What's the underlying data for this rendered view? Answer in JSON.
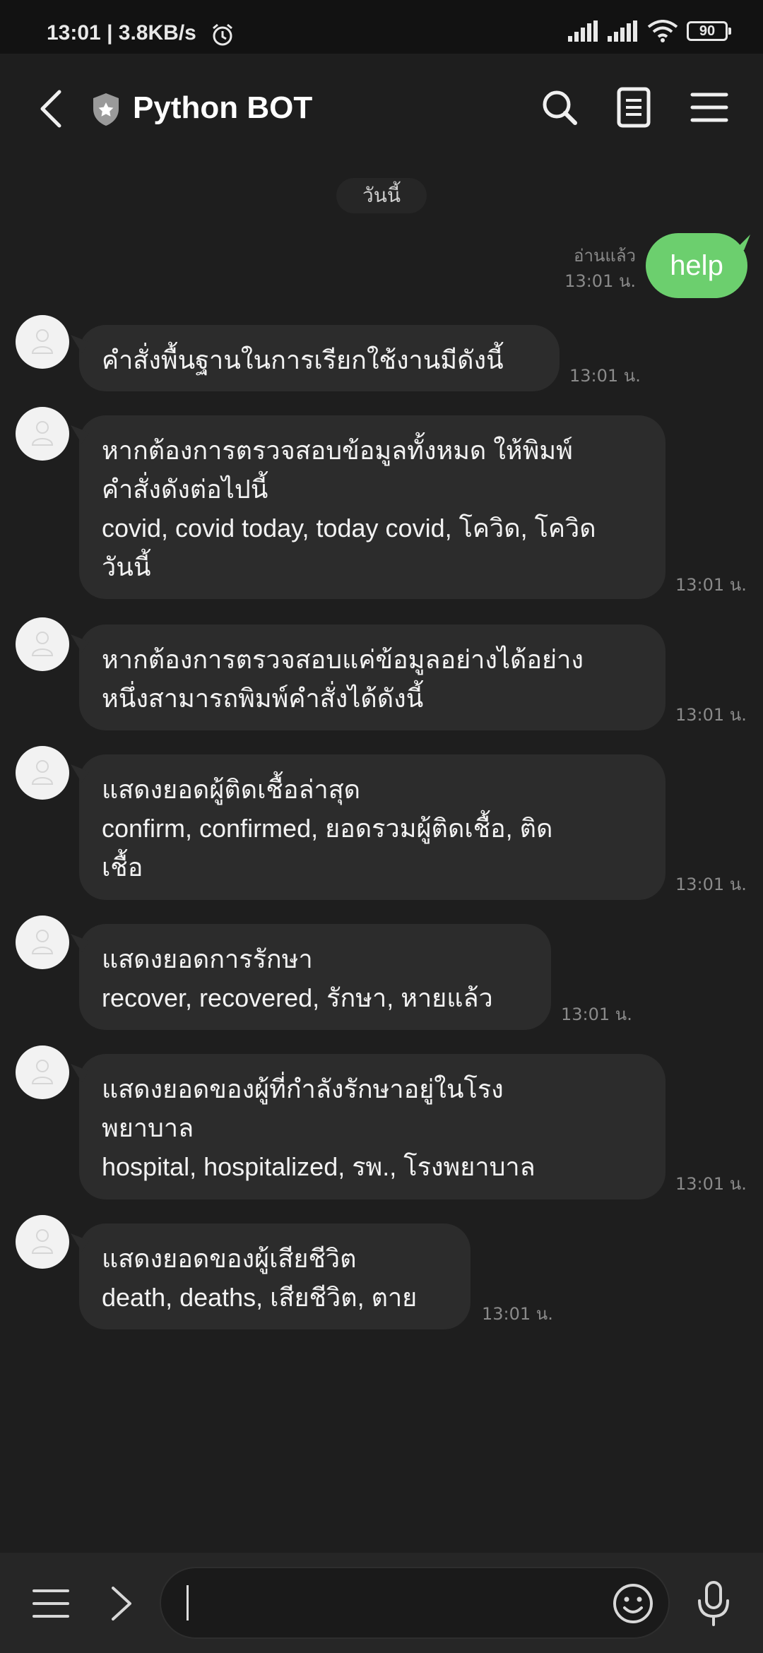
{
  "status_bar": {
    "time_speed": "13:01 | 3.8KB/s",
    "battery": "90",
    "icons": [
      "alarm-icon",
      "signal-icon",
      "signal-icon",
      "wifi-icon",
      "battery-icon"
    ]
  },
  "header": {
    "title": "Python BOT",
    "icons": [
      "back-icon",
      "shield-star-icon",
      "search-icon",
      "notes-icon",
      "menu-icon"
    ]
  },
  "chat": {
    "date_label": "วันนี้",
    "sent": {
      "status": "อ่านแล้ว",
      "time": "13:01 น.",
      "text": "help"
    },
    "received": [
      {
        "text": "คำสั่งพื้นฐานในการเรียกใช้งานมีดังนี้",
        "time": "13:01 น."
      },
      {
        "text": "หากต้องการตรวจสอบข้อมูลทั้งหมด ให้พิมพ์\nคำสั่งดังต่อไปนี้\ncovid, covid today, today covid, โควิด, โควิด\nวันนี้",
        "time": "13:01 น."
      },
      {
        "text": "หากต้องการตรวจสอบแค่ข้อมูลอย่างได้อย่าง\nหนึ่งสามารถพิมพ์คำสั่งได้ดังนี้",
        "time": "13:01 น."
      },
      {
        "text": "แสดงยอดผู้ติดเชื้อล่าสุด\nconfirm, confirmed, ยอดรวมผู้ติดเชื้อ, ติด\nเชื้อ",
        "time": "13:01 น."
      },
      {
        "text": "แสดงยอดการรักษา\nrecover, recovered, รักษา, หายแล้ว",
        "time": "13:01 น."
      },
      {
        "text": "แสดงยอดของผู้ที่กำลังรักษาอยู่ในโรง\nพยาบาล\nhospital, hospitalized, รพ., โรงพยาบาล",
        "time": "13:01 น."
      },
      {
        "text": "แสดงยอดของผู้เสียชีวิต\ndeath, deaths, เสียชีวิต, ตาย",
        "time": "13:01 น."
      }
    ]
  },
  "input_bar": {
    "value": "",
    "icons": [
      "menu-icon",
      "chevron-right-icon",
      "emoji-icon",
      "microphone-icon"
    ]
  },
  "colors": {
    "background": "#1e1e1e",
    "received_bubble": "#2c2c2c",
    "sent_bubble": "#6ccf6e",
    "timestamp": "#8a8a8a"
  }
}
